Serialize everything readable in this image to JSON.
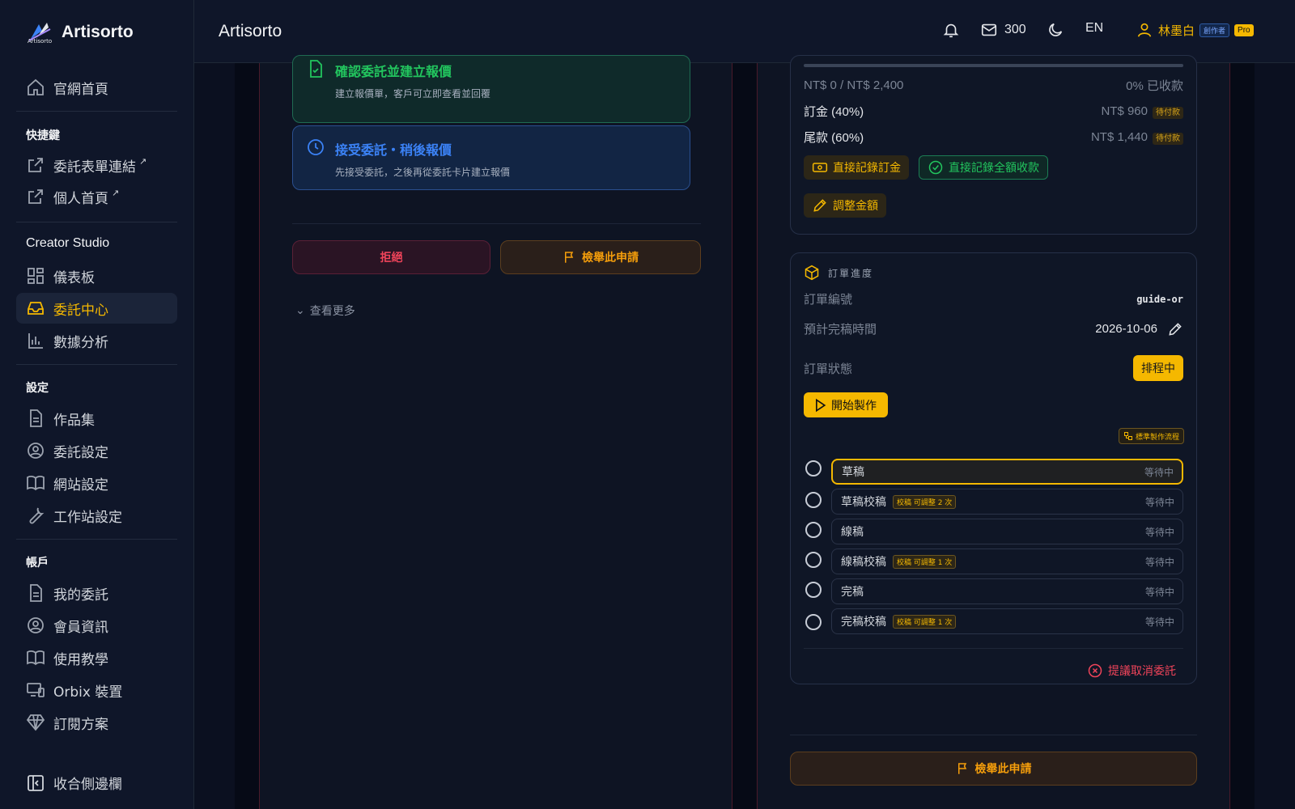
{
  "app": {
    "name": "Artisorto",
    "logo_sub": "Artisorto",
    "page_title": "Artisorto"
  },
  "sidebar": {
    "home": "官網首頁",
    "shortcuts_title": "快捷鍵",
    "shortcuts": [
      {
        "label": "委託表單連結",
        "ext": "↗"
      },
      {
        "label": "個人首頁",
        "ext": "↗"
      }
    ],
    "studio_title": "Creator Studio",
    "studio": [
      "儀表板",
      "委託中心",
      "數據分析"
    ],
    "settings_title": "設定",
    "settings": [
      "作品集",
      "委託設定",
      "網站設定",
      "工作站設定"
    ],
    "account_title": "帳戶",
    "account": [
      "我的委託",
      "會員資訊",
      "使用教學",
      "Orbix 裝置",
      "訂閱方案"
    ],
    "collapse": "收合側邊欄"
  },
  "topbar": {
    "messages": "300",
    "lang": "EN",
    "user": "林墨白",
    "role_badge": "創作者",
    "plan_badge": "Pro"
  },
  "left_panel": {
    "confirm_title": "確認委託並建立報價",
    "confirm_desc": "建立報價單，客戶可立即查看並回覆",
    "accept_title": "接受委託・稍後報價",
    "accept_desc": "先接受委託，之後再從委託卡片建立報價",
    "reject": "拒絕",
    "report": "檢舉此申請",
    "more": "查看更多"
  },
  "payment": {
    "summary": "NT$ 0 / NT$ 2,400",
    "percent": "0% 已收款",
    "deposit_label": "訂金 (40%)",
    "deposit_amount": "NT$ 960",
    "balance_label": "尾款 (60%)",
    "balance_amount": "NT$ 1,440",
    "due_tag": "待付款",
    "record_deposit": "直接記錄訂金",
    "record_full": "直接記錄全額收款",
    "adjust": "調整金額"
  },
  "order": {
    "heading": "訂單進度",
    "id_label": "訂單編號",
    "id_value": "guide-or",
    "eta_label": "預計完稿時間",
    "eta_value": "2026-10-06",
    "status_label": "訂單狀態",
    "status_value": "排程中",
    "start": "開始製作",
    "flow_tag": "標準製作流程",
    "steps": [
      {
        "name": "草稿",
        "tag": "",
        "state": "等待中"
      },
      {
        "name": "草稿校稿",
        "tag": "校稿  可調整 2 次",
        "state": "等待中"
      },
      {
        "name": "線稿",
        "tag": "",
        "state": "等待中"
      },
      {
        "name": "線稿校稿",
        "tag": "校稿  可調整 1 次",
        "state": "等待中"
      },
      {
        "name": "完稿",
        "tag": "",
        "state": "等待中"
      },
      {
        "name": "完稿校稿",
        "tag": "校稿  可調整 1 次",
        "state": "等待中"
      }
    ],
    "cancel": "提議取消委託",
    "report": "檢舉此申請"
  },
  "colors": {
    "accent": "#f5b800",
    "danger": "#f0445a",
    "success": "#22c55e",
    "info": "#3b82f6"
  }
}
